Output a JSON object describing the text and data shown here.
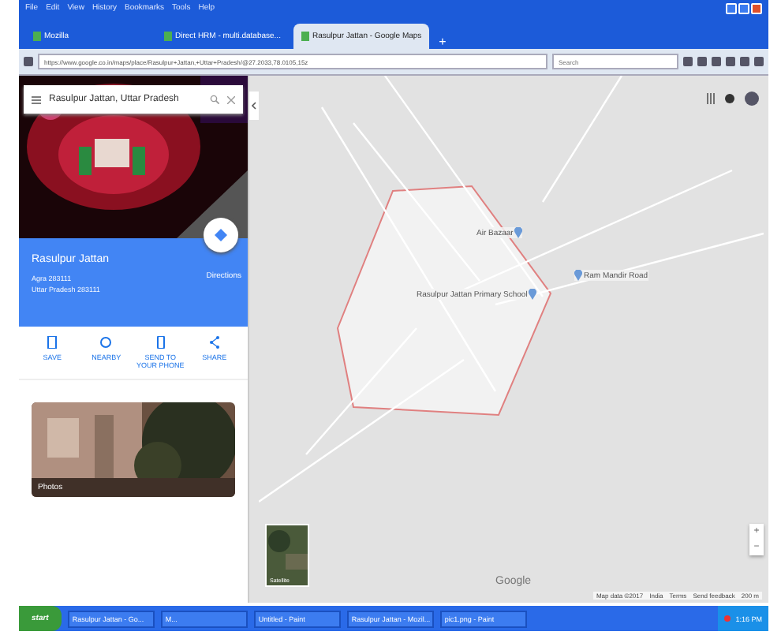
{
  "menu_bar": [
    "File",
    "Edit",
    "View",
    "History",
    "Bookmarks",
    "Tools",
    "Help"
  ],
  "tabs": [
    {
      "label": "Mozilla",
      "selected": false
    },
    {
      "label": "Direct HRM - multi.database...",
      "selected": false
    },
    {
      "label": "Rasulpur Jattan - Google Maps",
      "selected": true
    }
  ],
  "new_tab": "+",
  "address": "https://www.google.co.in/maps/place/Rasulpur+Jattan,+Uttar+Pradesh/@27.2033,78.0105,15z",
  "search_box": {
    "placeholder": "Search"
  },
  "panel": {
    "search": "Rasulpur Jattan, Uttar Pradesh",
    "title": "Rasulpur Jattan",
    "address_lines": [
      "Agra 283111",
      "Uttar Pradesh 283111"
    ],
    "directions": "Directions",
    "actions": [
      {
        "kind": "save",
        "label": "SAVE"
      },
      {
        "kind": "nearby",
        "label": "NEARBY"
      },
      {
        "kind": "phone",
        "label": "SEND TO YOUR PHONE"
      },
      {
        "kind": "share",
        "label": "SHARE"
      }
    ],
    "photos_label": "Photos"
  },
  "map": {
    "places": [
      {
        "name": "Air Bazaar"
      },
      {
        "name": "Rasulpur Jattan Primary School"
      },
      {
        "name": "Ram Mandir Road"
      }
    ],
    "satellite_label": "Satellite",
    "zoom_in": "+",
    "zoom_out": "−",
    "logo": "Google",
    "attribution": [
      "Map data ©2017",
      "India",
      "Terms",
      "Send feedback",
      "200 m"
    ]
  },
  "taskbar": {
    "start": "start",
    "items": [
      "Rasulpur Jattan - Go...",
      "M...",
      "Untitled - Paint",
      "Rasulpur Jattan - Mozil...",
      "pic1.png - Paint"
    ],
    "clock": "1:16 PM"
  }
}
